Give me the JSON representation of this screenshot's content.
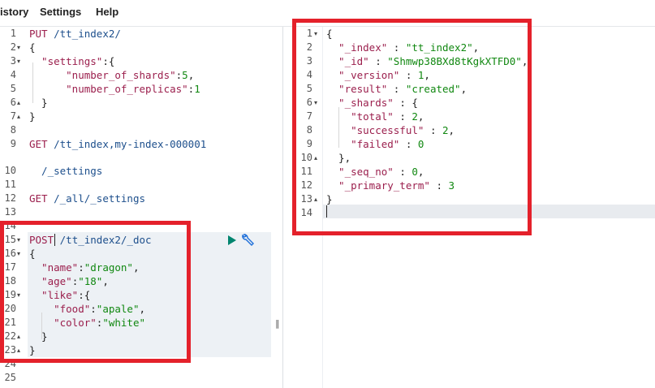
{
  "menu": {
    "history": "istory",
    "settings": "Settings",
    "help": "Help"
  },
  "left_editor": {
    "line_numbers": [
      "1",
      "2",
      "3",
      "4",
      "5",
      "6",
      "7",
      "8",
      "9",
      "10",
      "11",
      "12",
      "13",
      "14",
      "15",
      "16",
      "17",
      "18",
      "19",
      "20",
      "21",
      "22",
      "23",
      "24",
      "25"
    ],
    "lines": [
      {
        "parts": [
          {
            "t": "PUT ",
            "c": "k"
          },
          {
            "t": "/tt_index2/",
            "c": "u"
          }
        ]
      },
      {
        "parts": [
          {
            "t": "{",
            "c": "p"
          }
        ]
      },
      {
        "parts": [
          {
            "t": "  \"settings\"",
            "c": "k"
          },
          {
            "t": ":{",
            "c": "p"
          }
        ]
      },
      {
        "parts": [
          {
            "t": "      \"number_of_shards\"",
            "c": "k"
          },
          {
            "t": ":",
            "c": "p"
          },
          {
            "t": "5",
            "c": "n"
          },
          {
            "t": ",",
            "c": "p"
          }
        ]
      },
      {
        "parts": [
          {
            "t": "      \"number_of_replicas\"",
            "c": "k"
          },
          {
            "t": ":",
            "c": "p"
          },
          {
            "t": "1",
            "c": "n"
          }
        ]
      },
      {
        "parts": [
          {
            "t": "  }",
            "c": "p"
          }
        ]
      },
      {
        "parts": [
          {
            "t": "}",
            "c": "p"
          }
        ]
      },
      {
        "parts": []
      },
      {
        "parts": [
          {
            "t": "GET ",
            "c": "k"
          },
          {
            "t": "/tt_index,my-index-000001",
            "c": "u"
          }
        ]
      },
      {
        "parts": [
          {
            "t": "  /_settings",
            "c": "u"
          }
        ]
      },
      {
        "parts": []
      },
      {
        "parts": [
          {
            "t": "GET ",
            "c": "k"
          },
          {
            "t": "/_all/_settings",
            "c": "u"
          }
        ]
      },
      {
        "parts": []
      },
      {
        "parts": []
      },
      {
        "parts": [
          {
            "t": "POST ",
            "c": "k"
          },
          {
            "t": "/tt_index2/_doc",
            "c": "u"
          }
        ]
      },
      {
        "parts": [
          {
            "t": "{",
            "c": "p"
          }
        ]
      },
      {
        "parts": [
          {
            "t": "  \"name\"",
            "c": "k"
          },
          {
            "t": ":",
            "c": "p"
          },
          {
            "t": "\"dragon\"",
            "c": "s"
          },
          {
            "t": ",",
            "c": "p"
          }
        ]
      },
      {
        "parts": [
          {
            "t": "  \"age\"",
            "c": "k"
          },
          {
            "t": ":",
            "c": "p"
          },
          {
            "t": "\"18\"",
            "c": "s"
          },
          {
            "t": ",",
            "c": "p"
          }
        ]
      },
      {
        "parts": [
          {
            "t": "  \"like\"",
            "c": "k"
          },
          {
            "t": ":{",
            "c": "p"
          }
        ]
      },
      {
        "parts": [
          {
            "t": "    \"food\"",
            "c": "k"
          },
          {
            "t": ":",
            "c": "p"
          },
          {
            "t": "\"apale\"",
            "c": "s"
          },
          {
            "t": ",",
            "c": "p"
          }
        ]
      },
      {
        "parts": [
          {
            "t": "    \"color\"",
            "c": "k"
          },
          {
            "t": ":",
            "c": "p"
          },
          {
            "t": "\"white\"",
            "c": "s"
          }
        ]
      },
      {
        "parts": [
          {
            "t": "  }",
            "c": "p"
          }
        ]
      },
      {
        "parts": [
          {
            "t": "}",
            "c": "p"
          }
        ]
      },
      {
        "parts": []
      },
      {
        "parts": []
      }
    ]
  },
  "right_editor": {
    "line_numbers": [
      "1",
      "2",
      "3",
      "4",
      "5",
      "6",
      "7",
      "8",
      "9",
      "10",
      "11",
      "12",
      "13",
      "14"
    ],
    "lines": [
      {
        "parts": [
          {
            "t": "{",
            "c": "p"
          }
        ]
      },
      {
        "parts": [
          {
            "t": "  \"_index\"",
            "c": "k"
          },
          {
            "t": " : ",
            "c": "p"
          },
          {
            "t": "\"tt_index2\"",
            "c": "s"
          },
          {
            "t": ",",
            "c": "p"
          }
        ]
      },
      {
        "parts": [
          {
            "t": "  \"_id\"",
            "c": "k"
          },
          {
            "t": " : ",
            "c": "p"
          },
          {
            "t": "\"Shmwp38BXd8tKgkXTFD0\"",
            "c": "s"
          },
          {
            "t": ",",
            "c": "p"
          }
        ]
      },
      {
        "parts": [
          {
            "t": "  \"_version\"",
            "c": "k"
          },
          {
            "t": " : ",
            "c": "p"
          },
          {
            "t": "1",
            "c": "n"
          },
          {
            "t": ",",
            "c": "p"
          }
        ]
      },
      {
        "parts": [
          {
            "t": "  \"result\"",
            "c": "k"
          },
          {
            "t": " : ",
            "c": "p"
          },
          {
            "t": "\"created\"",
            "c": "s"
          },
          {
            "t": ",",
            "c": "p"
          }
        ]
      },
      {
        "parts": [
          {
            "t": "  \"_shards\"",
            "c": "k"
          },
          {
            "t": " : {",
            "c": "p"
          }
        ]
      },
      {
        "parts": [
          {
            "t": "    \"total\"",
            "c": "k"
          },
          {
            "t": " : ",
            "c": "p"
          },
          {
            "t": "2",
            "c": "n"
          },
          {
            "t": ",",
            "c": "p"
          }
        ]
      },
      {
        "parts": [
          {
            "t": "    \"successful\"",
            "c": "k"
          },
          {
            "t": " : ",
            "c": "p"
          },
          {
            "t": "2",
            "c": "n"
          },
          {
            "t": ",",
            "c": "p"
          }
        ]
      },
      {
        "parts": [
          {
            "t": "    \"failed\"",
            "c": "k"
          },
          {
            "t": " : ",
            "c": "p"
          },
          {
            "t": "0",
            "c": "n"
          }
        ]
      },
      {
        "parts": [
          {
            "t": "  },",
            "c": "p"
          }
        ]
      },
      {
        "parts": [
          {
            "t": "  \"_seq_no\"",
            "c": "k"
          },
          {
            "t": " : ",
            "c": "p"
          },
          {
            "t": "0",
            "c": "n"
          },
          {
            "t": ",",
            "c": "p"
          }
        ]
      },
      {
        "parts": [
          {
            "t": "  \"_primary_term\"",
            "c": "k"
          },
          {
            "t": " : ",
            "c": "p"
          },
          {
            "t": "3",
            "c": "n"
          }
        ]
      },
      {
        "parts": [
          {
            "t": "}",
            "c": "p"
          }
        ]
      },
      {
        "parts": []
      }
    ]
  },
  "colors": {
    "annotation": "#e4212b",
    "run": "#00856f",
    "wrench": "#1e6fd9"
  },
  "icons": {
    "run": "play-icon",
    "wrench": "wrench-icon",
    "resizer": "resize-handle-icon"
  }
}
